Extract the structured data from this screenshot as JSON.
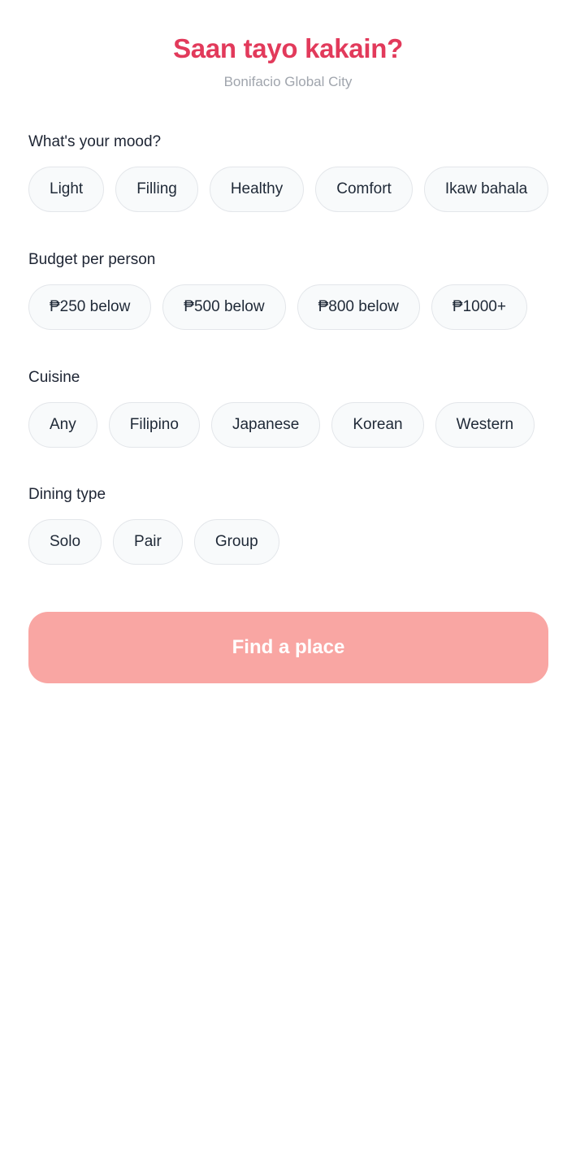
{
  "header": {
    "title": "Saan tayo kakain?",
    "location": "Bonifacio Global City"
  },
  "sections": {
    "mood": {
      "label": "What's your mood?",
      "options": [
        "Light",
        "Filling",
        "Healthy",
        "Comfort",
        "Ikaw bahala"
      ]
    },
    "budget": {
      "label": "Budget per person",
      "options": [
        "₱250 below",
        "₱500 below",
        "₱800 below",
        "₱1000+"
      ]
    },
    "cuisine": {
      "label": "Cuisine",
      "options": [
        "Any",
        "Filipino",
        "Japanese",
        "Korean",
        "Western"
      ]
    },
    "dining": {
      "label": "Dining type",
      "options": [
        "Solo",
        "Pair",
        "Group"
      ]
    }
  },
  "actions": {
    "find_label": "Find a place"
  },
  "colors": {
    "accent": "#e23a5b",
    "button_disabled": "#f9a6a3",
    "chip_border": "#e3e6ea",
    "chip_bg": "#f8fafb"
  }
}
